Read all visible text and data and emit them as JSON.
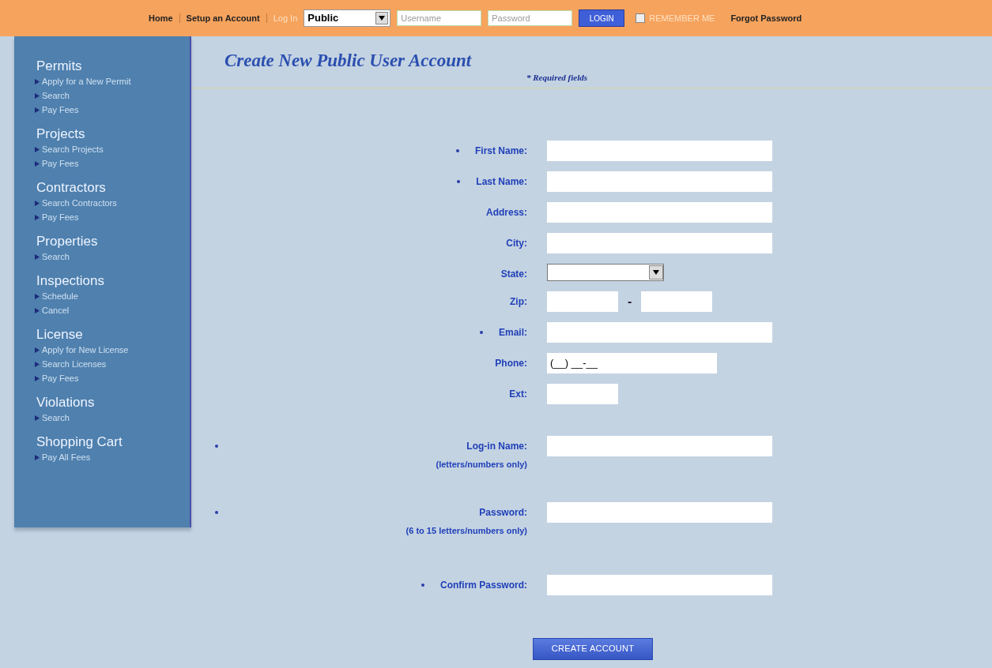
{
  "top_bar": {
    "links": [
      {
        "label": "Home",
        "kind": "link"
      },
      {
        "label": "Setup an Account",
        "kind": "link"
      }
    ],
    "login_label": "Log In",
    "account_type": {
      "value": "Public"
    },
    "username": {
      "placeholder": "Username"
    },
    "password": {
      "placeholder": "Password"
    },
    "login_button": "LOGIN",
    "remember_me": {
      "label": "REMEMBER ME",
      "checked": false
    },
    "forgot_password": "Forgot Password"
  },
  "sidebar": {
    "sections": [
      {
        "title": "Permits",
        "items": [
          "Apply for a New Permit",
          "Search",
          "Pay Fees"
        ]
      },
      {
        "title": "Projects",
        "items": [
          "Search Projects",
          "Pay Fees"
        ]
      },
      {
        "title": "Contractors",
        "items": [
          "Search Contractors",
          "Pay Fees"
        ]
      },
      {
        "title": "Properties",
        "items": [
          "Search"
        ]
      },
      {
        "title": "Inspections",
        "items": [
          "Schedule",
          "Cancel"
        ]
      },
      {
        "title": "License",
        "items": [
          "Apply for New License",
          "Search Licenses",
          "Pay Fees"
        ]
      },
      {
        "title": "Violations",
        "items": [
          "Search"
        ]
      },
      {
        "title": "Shopping Cart",
        "items": [
          "Pay All Fees"
        ]
      }
    ]
  },
  "form": {
    "title": "Create New Public User Account",
    "required_note": "* Required fields",
    "fields": [
      {
        "label": "First Name:",
        "kind": "text",
        "required": true
      },
      {
        "label": "Last Name:",
        "kind": "text",
        "required": true
      },
      {
        "label": "Address:",
        "kind": "text",
        "required": false
      },
      {
        "label": "City:",
        "kind": "text",
        "required": false
      },
      {
        "label": "State:",
        "kind": "select",
        "required": false
      },
      {
        "label": "Zip:",
        "kind": "zip",
        "required": false,
        "separator": "-"
      },
      {
        "label": "Email:",
        "kind": "text",
        "required": true
      },
      {
        "label": "Phone:",
        "kind": "phone",
        "required": false,
        "value": "(__) __-__"
      },
      {
        "label": "Ext:",
        "kind": "short",
        "required": false
      },
      {
        "label": "Log-in Name:",
        "kind": "text",
        "required": true,
        "sublabel": "(letters/numbers only)"
      },
      {
        "label": "Password:",
        "kind": "text",
        "required": true,
        "sublabel": "(6 to 15 letters/numbers only)"
      },
      {
        "label": "Confirm Password:",
        "kind": "text",
        "required": true
      }
    ],
    "submit": "CREATE ACCOUNT"
  }
}
